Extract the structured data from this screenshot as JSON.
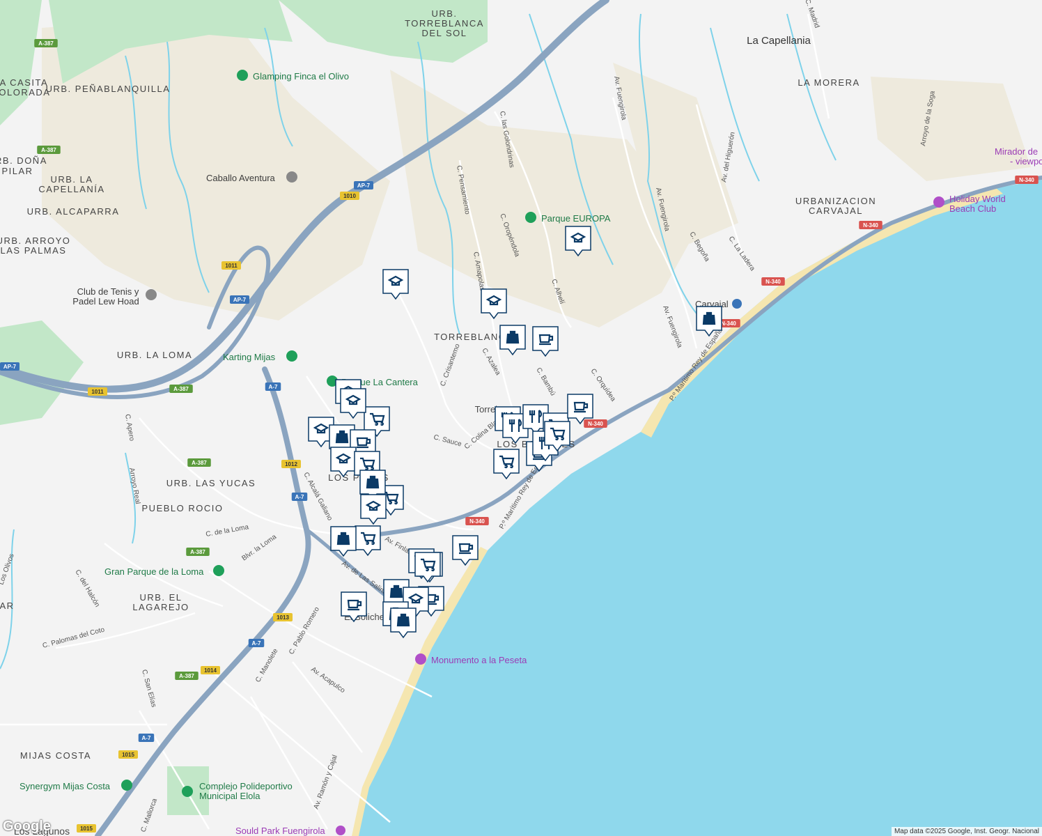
{
  "map": {
    "attribution": "Map data ©2025 Google, Inst. Geogr. Nacional",
    "logo": "Google",
    "colors": {
      "sea": "#8fd8ec",
      "land": "#f3f3f3",
      "park": "#b6e3c0",
      "urban": "#eeeae0",
      "highway": "#8aa0b8",
      "river": "#6fcfe8",
      "beach": "#f7e9b7",
      "marker": "#0b3a66"
    },
    "areas": [
      {
        "id": "urb-torreblanca-del-sol-1",
        "text": "URB."
      },
      {
        "id": "urb-torreblanca-del-sol-2",
        "text": "TORREBLANCA"
      },
      {
        "id": "urb-torreblanca-del-sol-3",
        "text": "DEL SOL"
      },
      {
        "id": "la-capellania",
        "text": "La Capellania"
      },
      {
        "id": "la-morera",
        "text": "LA MORERA"
      },
      {
        "id": "casita-1",
        "text": "LA CASITA"
      },
      {
        "id": "casita-2",
        "text": "COLORADA"
      },
      {
        "id": "penablanquilla",
        "text": "URB. PEÑABLANQUILLA"
      },
      {
        "id": "dona-1",
        "text": "URB. DOÑA"
      },
      {
        "id": "dona-2",
        "text": "PILAR"
      },
      {
        "id": "capellania-urb-1",
        "text": "URB. LA"
      },
      {
        "id": "capellania-urb-2",
        "text": "CAPELLANÍA"
      },
      {
        "id": "alcaparra",
        "text": "URB. ALCAPARRA"
      },
      {
        "id": "arroyo-1",
        "text": "URB. ARROYO"
      },
      {
        "id": "arroyo-2",
        "text": "LAS PALMAS"
      },
      {
        "id": "la-loma",
        "text": "URB. LA LOMA"
      },
      {
        "id": "urbanizacion-1",
        "text": "URBANIZACION"
      },
      {
        "id": "urbanizacion-2",
        "text": "CARVAJAL"
      },
      {
        "id": "torreblanca",
        "text": "TORREBLANCA"
      },
      {
        "id": "los-boliches",
        "text": "LOS BOLICHES"
      },
      {
        "id": "las-yucas",
        "text": "URB. LAS YUCAS"
      },
      {
        "id": "pueblo-rocio",
        "text": "PUEBLO ROCIO"
      },
      {
        "id": "lagarejo-1",
        "text": "URB. EL"
      },
      {
        "id": "lagarejo-2",
        "text": "LAGAREJO"
      },
      {
        "id": "mijas-costa",
        "text": "MIJAS COSTA"
      },
      {
        "id": "los-lagunos",
        "text": "Los Lagunos"
      },
      {
        "id": "los-pacos",
        "text": "LOS PACOS"
      },
      {
        "id": "el-boliche",
        "text": "El Boliche"
      },
      {
        "id": "torreb-2",
        "text": "Torreb"
      },
      {
        "id": "ar",
        "text": "AR"
      }
    ],
    "pois": [
      {
        "id": "glamping",
        "text": "Glamping Finca el Olivo",
        "icon": "campground-icon"
      },
      {
        "id": "caballo",
        "text": "Caballo Aventura",
        "icon": "place-icon"
      },
      {
        "id": "club-tenis-1",
        "text": "Club de Tenis y",
        "icon": "place-icon"
      },
      {
        "id": "club-tenis-2",
        "text": "Padel Lew Hoad",
        "icon": ""
      },
      {
        "id": "karting",
        "text": "Karting Mijas",
        "icon": "place-icon"
      },
      {
        "id": "parque-cantera",
        "text": "Parque La Cantera",
        "icon": "park-icon"
      },
      {
        "id": "parque-europa",
        "text": "Parque EUROPA",
        "icon": "park-icon"
      },
      {
        "id": "carvajal",
        "text": "Carvajal",
        "icon": "train-icon"
      },
      {
        "id": "holiday-1",
        "text": "Holiday World",
        "icon": "attraction-icon"
      },
      {
        "id": "holiday-2",
        "text": "Beach Club",
        "icon": ""
      },
      {
        "id": "mirador-1",
        "text": "Mirador de",
        "icon": ""
      },
      {
        "id": "mirador-2",
        "text": "- viewpo",
        "icon": ""
      },
      {
        "id": "gran-parque",
        "text": "Gran Parque de la Loma",
        "icon": "park-icon"
      },
      {
        "id": "monumento",
        "text": "Monumento a la Peseta",
        "icon": "camera-icon"
      },
      {
        "id": "synergym",
        "text": "Synergym Mijas Costa",
        "icon": "place-icon"
      },
      {
        "id": "complejo-1",
        "text": "Complejo Polideportivo",
        "icon": "place-icon"
      },
      {
        "id": "complejo-2",
        "text": "Municipal Elola",
        "icon": ""
      },
      {
        "id": "sould",
        "text": "Sould Park Fuengirola",
        "icon": "place-icon"
      }
    ],
    "streets": [
      {
        "id": "golondrinas",
        "text": "C. las Golondrinas"
      },
      {
        "id": "pensamiento",
        "text": "C. Pensamiento"
      },
      {
        "id": "oropendola",
        "text": "C. Oropéndola"
      },
      {
        "id": "amapolas",
        "text": "C. Amapolas"
      },
      {
        "id": "alheli",
        "text": "C. Alhelí"
      },
      {
        "id": "azalea",
        "text": "C. Azalea"
      },
      {
        "id": "bambu",
        "text": "C. Bambú"
      },
      {
        "id": "orquidea",
        "text": "C. Orquídea"
      },
      {
        "id": "crisantemo",
        "text": "C. Crisantemo"
      },
      {
        "id": "sauce",
        "text": "C. Sauce"
      },
      {
        "id": "colina",
        "text": "C. Colina Blanca"
      },
      {
        "id": "av-fuengirola-1",
        "text": "Av. Fuengirola"
      },
      {
        "id": "av-fuengirola-2",
        "text": "Av. Fuengirola"
      },
      {
        "id": "av-fuengirola-3",
        "text": "Av. Fuengirola"
      },
      {
        "id": "higueron",
        "text": "Av. del Higuerón"
      },
      {
        "id": "begona",
        "text": "C. Begoña"
      },
      {
        "id": "ladera",
        "text": "C. La Ladera"
      },
      {
        "id": "madrid",
        "text": "C. Madrid"
      },
      {
        "id": "arroyo-soga",
        "text": "Arroyo de la Soga"
      },
      {
        "id": "paseo-1",
        "text": "P.º Marítimo Rey de España"
      },
      {
        "id": "paseo-2",
        "text": "P.º Marítimo Rey de España"
      },
      {
        "id": "alcala",
        "text": "C. Alcalá Galiano"
      },
      {
        "id": "finlandia",
        "text": "Av. Finlandia"
      },
      {
        "id": "salinas",
        "text": "Av. de Las Salinas"
      },
      {
        "id": "de-la-loma",
        "text": "C. de la Loma"
      },
      {
        "id": "blvr-loma",
        "text": "Blvr. la Loma"
      },
      {
        "id": "apero",
        "text": "C. Apero"
      },
      {
        "id": "arroyo-real",
        "text": "Arroyo Real"
      },
      {
        "id": "halcon",
        "text": "C. del Halcón"
      },
      {
        "id": "los-olivos",
        "text": "Los Olivos"
      },
      {
        "id": "palomas",
        "text": "C. Palomas del Coto"
      },
      {
        "id": "san-elias",
        "text": "C. San Elías"
      },
      {
        "id": "manolete",
        "text": "C. Manolete"
      },
      {
        "id": "pablo-romero",
        "text": "C. Pablo Romero"
      },
      {
        "id": "acapulco",
        "text": "Av. Acapulco"
      },
      {
        "id": "ramon-cajal",
        "text": "Av. Ramón y Cajal"
      },
      {
        "id": "mallorca",
        "text": "C. Mallorca"
      }
    ],
    "shields": [
      {
        "id": "a387-1",
        "text": "A-387",
        "color": "#5b9a3c"
      },
      {
        "id": "a387-2",
        "text": "A-387",
        "color": "#5b9a3c"
      },
      {
        "id": "a387-3",
        "text": "A-387",
        "color": "#5b9a3c"
      },
      {
        "id": "a387-4",
        "text": "A-387",
        "color": "#5b9a3c"
      },
      {
        "id": "a387-5",
        "text": "A-387",
        "color": "#5b9a3c"
      },
      {
        "id": "a387-6",
        "text": "A-387",
        "color": "#5b9a3c"
      },
      {
        "id": "ap7-1",
        "text": "AP-7",
        "color": "#3a74b8"
      },
      {
        "id": "ap7-2",
        "text": "AP-7",
        "color": "#3a74b8"
      },
      {
        "id": "ap7-3",
        "text": "AP-7",
        "color": "#3a74b8"
      },
      {
        "id": "a7-1",
        "text": "A-7",
        "color": "#3a74b8"
      },
      {
        "id": "a7-2",
        "text": "A-7",
        "color": "#3a74b8"
      },
      {
        "id": "a7-3",
        "text": "A-7",
        "color": "#3a74b8"
      },
      {
        "id": "a7-4",
        "text": "A-7",
        "color": "#3a74b8"
      },
      {
        "id": "n340-1",
        "text": "N-340",
        "color": "#d9534f"
      },
      {
        "id": "n340-2",
        "text": "N-340",
        "color": "#d9534f"
      },
      {
        "id": "n340-3",
        "text": "N-340",
        "color": "#d9534f"
      },
      {
        "id": "n340-4",
        "text": "N-340",
        "color": "#d9534f"
      },
      {
        "id": "n340-5",
        "text": "N-340",
        "color": "#d9534f"
      },
      {
        "id": "n340-6",
        "text": "N-340",
        "color": "#d9534f"
      },
      {
        "id": "1010",
        "text": "1010",
        "color": "#e8c330"
      },
      {
        "id": "1011a",
        "text": "1011",
        "color": "#e8c330"
      },
      {
        "id": "1011b",
        "text": "1011",
        "color": "#e8c330"
      },
      {
        "id": "1012",
        "text": "1012",
        "color": "#e8c330"
      },
      {
        "id": "1013",
        "text": "1013",
        "color": "#e8c330"
      },
      {
        "id": "1014",
        "text": "1014",
        "color": "#e8c330"
      },
      {
        "id": "1015a",
        "text": "1015",
        "color": "#e8c330"
      },
      {
        "id": "1015b",
        "text": "1015",
        "color": "#e8c330"
      }
    ],
    "markers": [
      {
        "type": "school-icon"
      },
      {
        "type": "school-icon"
      },
      {
        "type": "school-icon"
      },
      {
        "type": "shopping-bag-icon"
      },
      {
        "type": "coffee-icon"
      },
      {
        "type": "shopping-bag-icon"
      },
      {
        "type": "school-icon"
      },
      {
        "type": "school-icon"
      },
      {
        "type": "shopping-cart-icon"
      },
      {
        "type": "school-icon"
      },
      {
        "type": "shopping-bag-icon"
      },
      {
        "type": "coffee-icon"
      },
      {
        "type": "school-icon"
      },
      {
        "type": "shopping-cart-icon"
      },
      {
        "type": "shopping-cart-icon"
      },
      {
        "type": "shopping-bag-icon"
      },
      {
        "type": "shopping-cart-icon"
      },
      {
        "type": "school-icon"
      },
      {
        "type": "shopping-bag-icon"
      },
      {
        "type": "shopping-cart-icon"
      },
      {
        "type": "shopping-cart-icon"
      },
      {
        "type": "restaurant-icon"
      },
      {
        "type": "restaurant-icon"
      },
      {
        "type": "restaurant-icon"
      },
      {
        "type": "shopping-cart-icon"
      },
      {
        "type": "coffee-icon"
      },
      {
        "type": "coffee-icon"
      },
      {
        "type": "restaurant-icon"
      },
      {
        "type": "shopping-cart-icon"
      },
      {
        "type": "coffee-icon"
      },
      {
        "type": "coffee-icon"
      },
      {
        "type": "shopping-cart-icon"
      },
      {
        "type": "shopping-cart-icon"
      },
      {
        "type": "shopping-bag-icon"
      },
      {
        "type": "school-icon"
      },
      {
        "type": "coffee-icon"
      },
      {
        "type": "shopping-bag-icon"
      },
      {
        "type": "shopping-bag-icon"
      }
    ]
  }
}
